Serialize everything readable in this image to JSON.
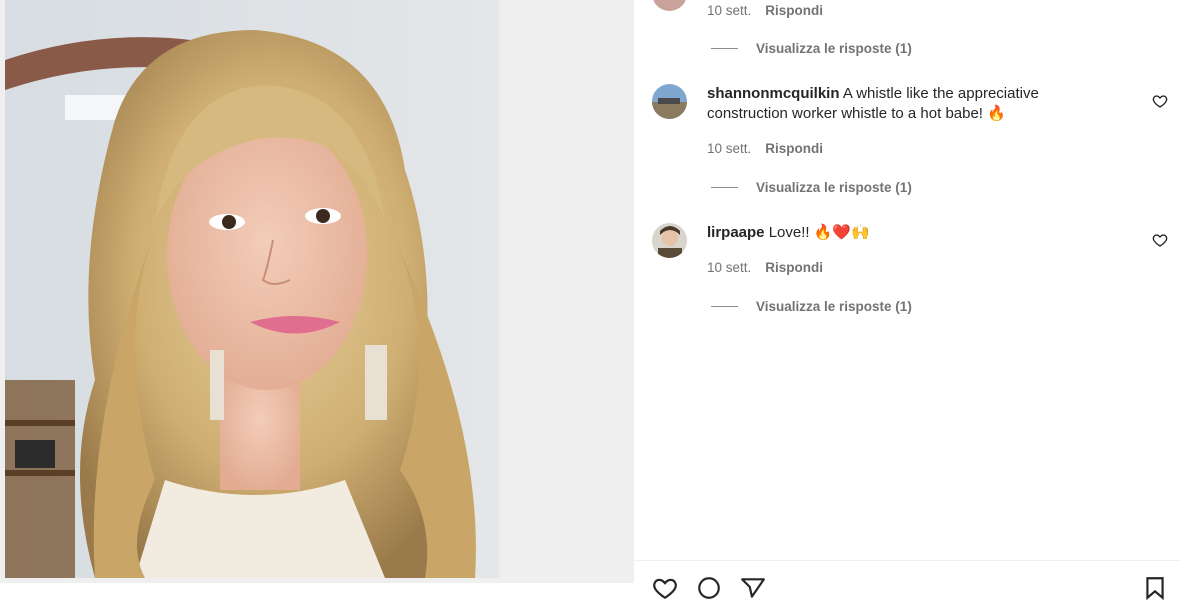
{
  "comments": [
    {
      "time": "10 sett.",
      "reply_label": "Rispondi",
      "view_replies": "Visualizza le risposte (1)"
    },
    {
      "username": "shannonmcquilkin",
      "text": "A whistle like the appreciative construction worker whistle to a hot babe! 🔥",
      "time": "10 sett.",
      "reply_label": "Rispondi",
      "view_replies": "Visualizza le risposte (1)"
    },
    {
      "username": "lirpaape",
      "text": "Love!! 🔥❤️🙌",
      "time": "10 sett.",
      "reply_label": "Rispondi",
      "view_replies": "Visualizza le risposte (1)"
    }
  ],
  "icons": {
    "like": "heart-icon",
    "comment": "comment-icon",
    "share": "send-icon",
    "save": "bookmark-icon"
  },
  "colors": {
    "text": "#262626",
    "secondary_text": "#737373",
    "media_background": "#efefef"
  }
}
